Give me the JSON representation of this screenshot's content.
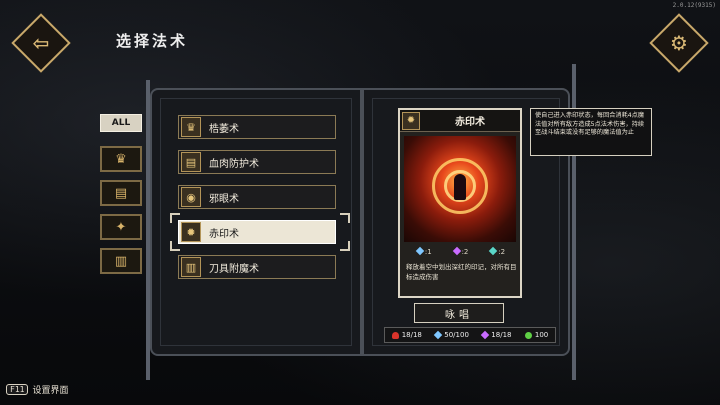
{
  "version": "2.0.12(9315)",
  "title": "选择法术",
  "icons": {
    "back": "back-arrow-icon",
    "settings": "gear-icon"
  },
  "categories": {
    "all_label": "ALL",
    "tabs": [
      {
        "icon": "spell-tome-icon",
        "glyph": "♛"
      },
      {
        "icon": "cards-icon",
        "glyph": "▤"
      },
      {
        "icon": "sparkle-icon",
        "glyph": "✦"
      },
      {
        "icon": "scroll-icon",
        "glyph": "▥"
      }
    ]
  },
  "spells": [
    {
      "name": "梏萎术",
      "glyph": "♛",
      "selected": false
    },
    {
      "name": "血肉防护术",
      "glyph": "▤",
      "selected": false
    },
    {
      "name": "邪眼术",
      "glyph": "◉",
      "selected": false
    },
    {
      "name": "赤印术",
      "glyph": "✹",
      "selected": true
    },
    {
      "name": "刀具附魔术",
      "glyph": "▥",
      "selected": false
    }
  ],
  "card": {
    "title": "赤印术",
    "stats": [
      {
        "value": ":1",
        "color": "#7fc7ff"
      },
      {
        "value": ":2",
        "color": "#c96bff"
      },
      {
        "value": ":2",
        "color": "#5ad6c8"
      }
    ],
    "description": "释放着空中划出深红的印记，对所有目标造成伤害"
  },
  "tooltip": "使自己进入赤印状态，每回合消耗4点魔法值对所有敌方造成5点法术伤害，持续至战斗结束或没有足够的魔法值为止",
  "chant_label": "咏唱",
  "resources": {
    "health": "18/18",
    "mana": "50/100",
    "sanity": "18/18",
    "luck": "100",
    "colors": {
      "health": "#d9342b",
      "mana": "#7fc7ff",
      "sanity": "#c96bff",
      "luck": "#5fcf45"
    }
  },
  "footer": {
    "key": "F11",
    "label": "设置界面"
  }
}
